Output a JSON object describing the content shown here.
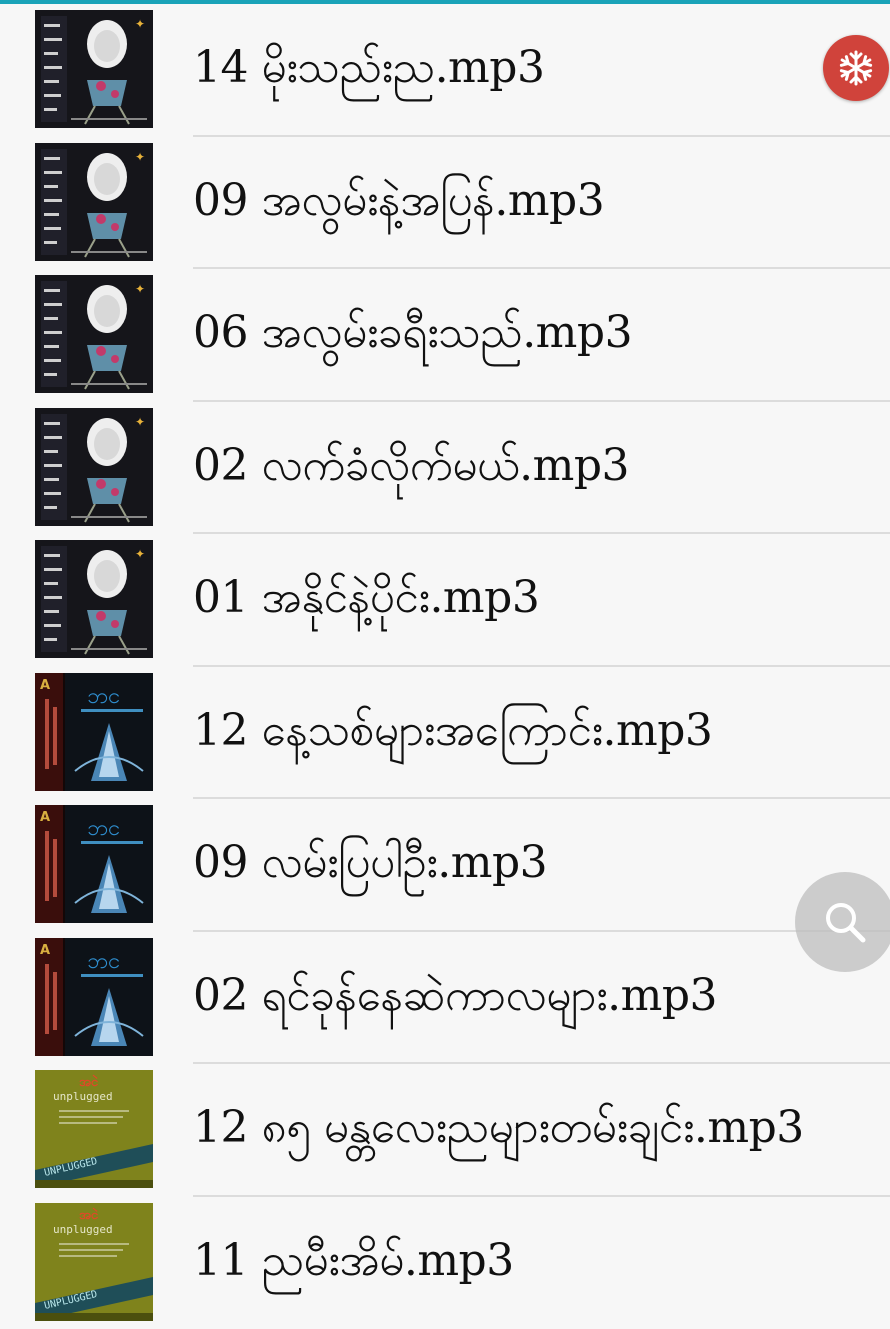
{
  "colors": {
    "accent": "#1aa3b8",
    "fab_red": "#d0433b",
    "divider": "#dcdcdc"
  },
  "songs": [
    {
      "title": "14 မိုးသည်းည.mp3",
      "art": "album-a"
    },
    {
      "title": "09 အလွမ်းနဲ့အပြန်.mp3",
      "art": "album-a"
    },
    {
      "title": "06 အလွမ်းခရီးသည်.mp3",
      "art": "album-a"
    },
    {
      "title": "02 လက်ခံလိုက်မယ်.mp3",
      "art": "album-a"
    },
    {
      "title": "01 အနိုင်နဲ့ပိုင်း.mp3",
      "art": "album-a"
    },
    {
      "title": "12 နေ့သစ်များအကြောင်း.mp3",
      "art": "album-b"
    },
    {
      "title": "09 လမ်းပြပါဦး.mp3",
      "art": "album-b"
    },
    {
      "title": "02 ရင်ခုန်နေဆဲကာလများ.mp3",
      "art": "album-b"
    },
    {
      "title": "12 ၈၅ မန္တလေးညများတမ်းချင်း.mp3",
      "art": "album-c"
    },
    {
      "title": "11 ညမီးအိမ်.mp3",
      "art": "album-c"
    }
  ],
  "fab": {
    "top_icon": "snowflake-icon",
    "search_icon": "search-icon"
  }
}
